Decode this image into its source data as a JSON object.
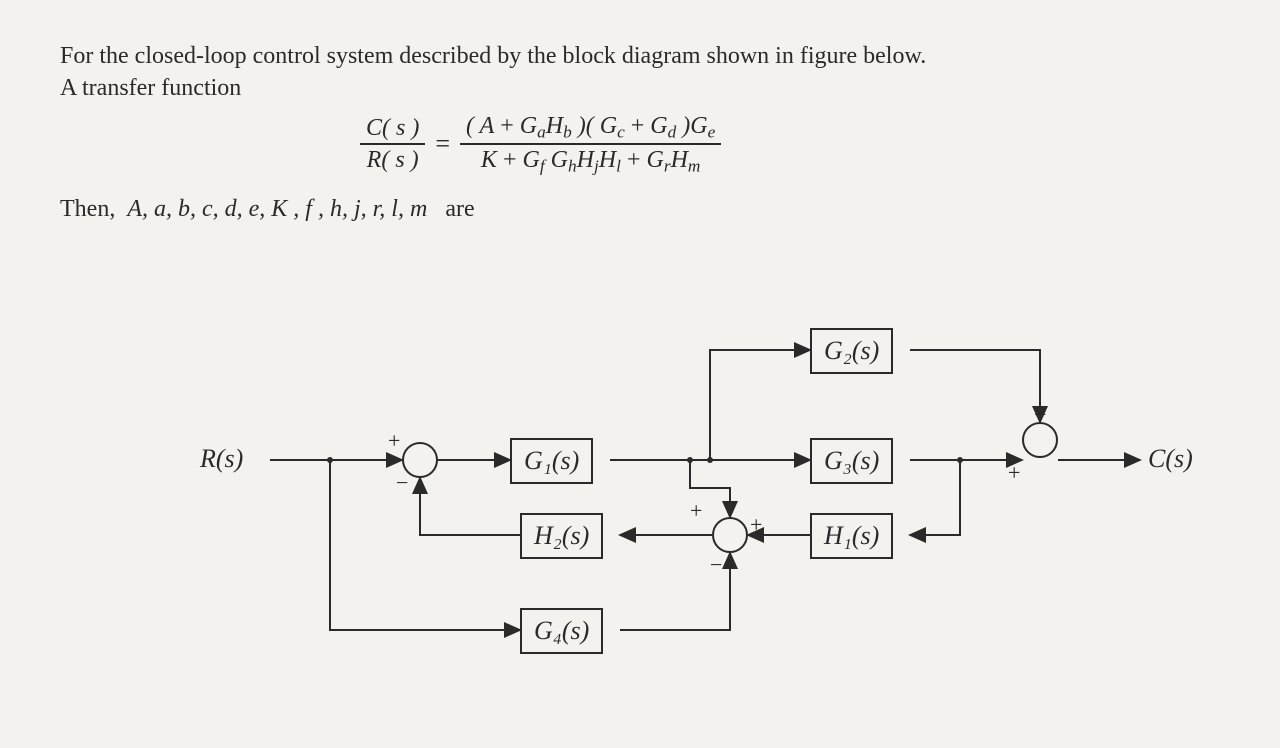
{
  "problem": {
    "line1": "For the closed-loop control system described by the block diagram shown in figure below.",
    "line2": "A transfer function",
    "tf_left_num": "C( s )",
    "tf_left_den": "R( s )",
    "tf_right_num": "( A + GₐH_b )( G_c + G_d )G_e",
    "tf_right_den": "K + G_f G_h H_j H_l + G_r H_m",
    "then": "Then,  A, a, b, c, d, e, K , f , h, j, r, l, m   are"
  },
  "diagram": {
    "input": "R(s)",
    "output": "C(s)",
    "blocks": {
      "G1": "G₁(s)",
      "G2": "G₂(s)",
      "G3": "G₃(s)",
      "G4": "G₄(s)",
      "H1": "H₁(s)",
      "H2": "H₂(s)"
    },
    "sum1": {
      "plus": "+",
      "minus": "−"
    },
    "sum2": {
      "plus_top": "+",
      "plus_right": "+",
      "minus": "−"
    },
    "sum3": {
      "plus_top": "+",
      "plus_left": "+"
    }
  },
  "chart_data": {
    "type": "block-diagram",
    "nodes": [
      {
        "id": "Rin",
        "kind": "signal",
        "label": "R(s)"
      },
      {
        "id": "S1",
        "kind": "summing",
        "signs": {
          "left": "+",
          "bottom": "-"
        }
      },
      {
        "id": "G1",
        "kind": "block",
        "label": "G1(s)"
      },
      {
        "id": "G2",
        "kind": "block",
        "label": "G2(s)"
      },
      {
        "id": "G3",
        "kind": "block",
        "label": "G3(s)"
      },
      {
        "id": "S3",
        "kind": "summing",
        "signs": {
          "top": "+",
          "left": "+"
        }
      },
      {
        "id": "Cout",
        "kind": "signal",
        "label": "C(s)"
      },
      {
        "id": "H1",
        "kind": "block",
        "label": "H1(s)"
      },
      {
        "id": "S2",
        "kind": "summing",
        "signs": {
          "top": "+",
          "right": "+",
          "bottom": "-"
        }
      },
      {
        "id": "H2",
        "kind": "block",
        "label": "H2(s)"
      },
      {
        "id": "G4",
        "kind": "block",
        "label": "G4(s)"
      }
    ],
    "edges": [
      {
        "from": "Rin",
        "to": "S1"
      },
      {
        "from": "S1",
        "to": "G1"
      },
      {
        "from": "G1",
        "to": "G2",
        "note": "branch up"
      },
      {
        "from": "G1",
        "to": "G3"
      },
      {
        "from": "G2",
        "to": "S3",
        "port": "top"
      },
      {
        "from": "G3",
        "to": "S3",
        "port": "left"
      },
      {
        "from": "S3",
        "to": "Cout"
      },
      {
        "from": "G3",
        "to": "H1",
        "note": "feedback tap after G3"
      },
      {
        "from": "H1",
        "to": "S2",
        "port": "right"
      },
      {
        "from": "G1",
        "to": "S2",
        "port": "top",
        "note": "tap after G1"
      },
      {
        "from": "Rin",
        "to": "G4",
        "note": "feedforward tap from input"
      },
      {
        "from": "G4",
        "to": "S2",
        "port": "bottom"
      },
      {
        "from": "S2",
        "to": "H2"
      },
      {
        "from": "H2",
        "to": "S1",
        "port": "bottom",
        "note": "feedback"
      }
    ],
    "transfer_function": "C(s)/R(s) = (A + Ga*Hb)(Gc + Gd)Ge / (K + Gf*Gh*Hj*Hl + Gr*Hm)",
    "unknowns": [
      "A",
      "a",
      "b",
      "c",
      "d",
      "e",
      "K",
      "f",
      "h",
      "j",
      "r",
      "l",
      "m"
    ]
  }
}
